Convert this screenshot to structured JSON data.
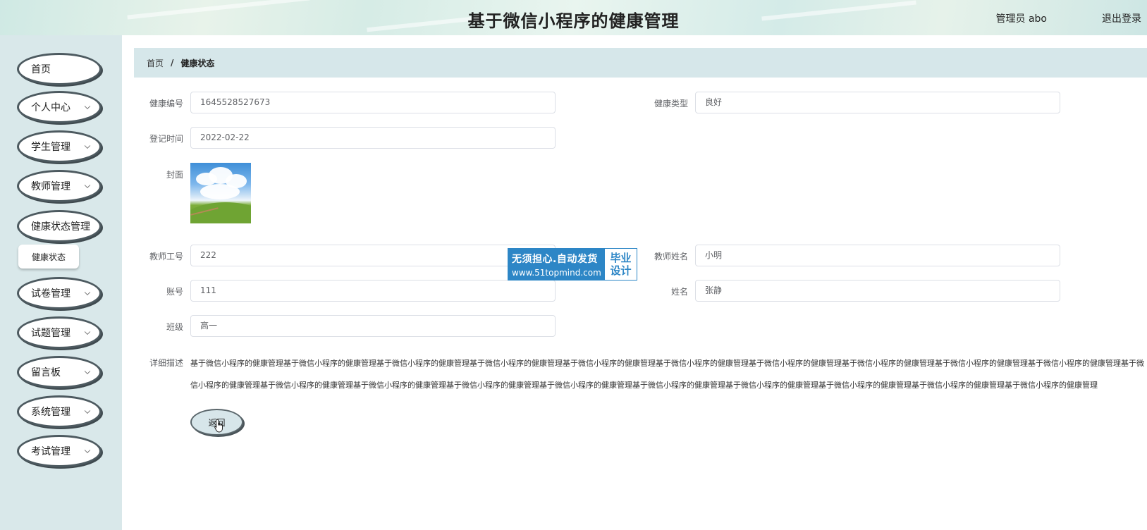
{
  "header": {
    "title": "基于微信小程序的健康管理",
    "user_label": "管理员 abo",
    "logout_label": "退出登录"
  },
  "sidebar": {
    "items": [
      {
        "label": "首页",
        "has_chevron": false
      },
      {
        "label": "个人中心",
        "has_chevron": true
      },
      {
        "label": "学生管理",
        "has_chevron": true
      },
      {
        "label": "教师管理",
        "has_chevron": true
      },
      {
        "label": "健康状态管理",
        "has_chevron": false
      },
      {
        "label": "试卷管理",
        "has_chevron": true
      },
      {
        "label": "试题管理",
        "has_chevron": true
      },
      {
        "label": "留言板",
        "has_chevron": true
      },
      {
        "label": "系统管理",
        "has_chevron": true
      },
      {
        "label": "考试管理",
        "has_chevron": true
      }
    ],
    "sub_item": "健康状态"
  },
  "breadcrumb": {
    "home": "首页",
    "separator": "/",
    "current": "健康状态"
  },
  "form": {
    "health_no": {
      "label": "健康编号",
      "value": "1645528527673"
    },
    "health_type": {
      "label": "健康类型",
      "value": "良好"
    },
    "register_time": {
      "label": "登记时间",
      "value": "2022-02-22"
    },
    "cover": {
      "label": "封面"
    },
    "teacher_no": {
      "label": "教师工号",
      "value": "222"
    },
    "teacher_name": {
      "label": "教师姓名",
      "value": "小明"
    },
    "account": {
      "label": "账号",
      "value": "111"
    },
    "name": {
      "label": "姓名",
      "value": "张静"
    },
    "class": {
      "label": "班级",
      "value": "高一"
    },
    "detail": {
      "label": "详细描述",
      "value": "基于微信小程序的健康管理基于微信小程序的健康管理基于微信小程序的健康管理基于微信小程序的健康管理基于微信小程序的健康管理基于微信小程序的健康管理基于微信小程序的健康管理基于微信小程序的健康管理基于微信小程序的健康管理基于微信小程序的健康管理基于微信小程序的健康管理基于微信小程序的健康管理基于微信小程序的健康管理基于微信小程序的健康管理基于微信小程序的健康管理基于微信小程序的健康管理基于微信小程序的健康管理基于微信小程序的健康管理基于微信小程序的健康管理基于微信小程序的健康管理"
    },
    "back_label": "返回"
  },
  "watermark": {
    "line1": "无须担心.自动发货",
    "line2": "www.51topmind.com",
    "side1": "毕业",
    "side2": "设计"
  },
  "colors": {
    "sidebar_bg": "#d9e8ea",
    "breadcrumb_bg": "#d6e7ea",
    "watermark_blue": "#2d86c6"
  }
}
